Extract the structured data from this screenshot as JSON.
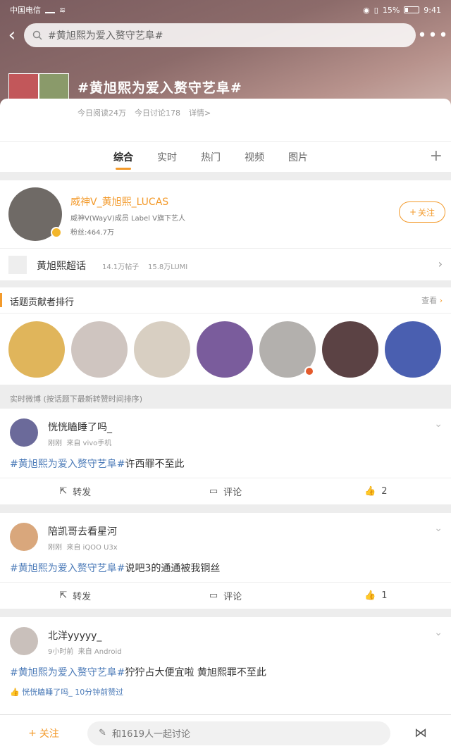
{
  "status": {
    "carrier": "中国电信",
    "battery": "15%",
    "time": "9:41"
  },
  "search": {
    "placeholder": "#黄旭熙为爱入赘守艺阜#"
  },
  "topic": {
    "title": "#黄旭熙为爱入赘守艺阜#",
    "read": "今日阅读24万",
    "discuss": "今日讨论178",
    "detail": "详情>"
  },
  "tabs": [
    "综合",
    "实时",
    "热门",
    "视频",
    "图片"
  ],
  "profile": {
    "name": "威神V_黄旭熙_LUCAS",
    "desc": "威神V(WayV)成员 Label V旗下艺人",
    "fans": "粉丝:464.7万",
    "follow": "关注"
  },
  "super": {
    "label": "黄旭熙超话",
    "posts": "14.1万帖子",
    "lumi": "15.8万LUMI"
  },
  "ranking": {
    "title": "话题贡献者排行",
    "view": "查看"
  },
  "realtime_label": "实时微博 (按话题下最新转赞时间排序)",
  "posts": [
    {
      "user": "恍恍瞌睡了吗_",
      "time": "刚刚",
      "source": "来自 vivo手机",
      "tag": "#黄旭熙为爱入赘守艺阜#",
      "text": "许西罪不至此",
      "forward": "转发",
      "comment": "评论",
      "likes": "2"
    },
    {
      "user": "陪凯哥去看星河",
      "time": "刚刚",
      "source": "来自 iQOO U3x",
      "tag": "#黄旭熙为爱入赘守艺阜#",
      "text": "说吧3的通通被我铜丝",
      "forward": "转发",
      "comment": "评论",
      "likes": "1"
    },
    {
      "user": "北洋yyyyy_",
      "time": "9小时前",
      "source": "来自 Android",
      "tag": "#黄旭熙为爱入赘守艺阜#",
      "text": "狞狞占大便宜啦 黄旭熙罪不至此",
      "liked_by": "恍恍瞌睡了吗_ 10分钟前赞过"
    }
  ],
  "bottom": {
    "follow": "关注",
    "input": "和1619人一起讨论"
  },
  "colors": {
    "accent": "#f39a2b",
    "link": "#4c7bb8"
  }
}
